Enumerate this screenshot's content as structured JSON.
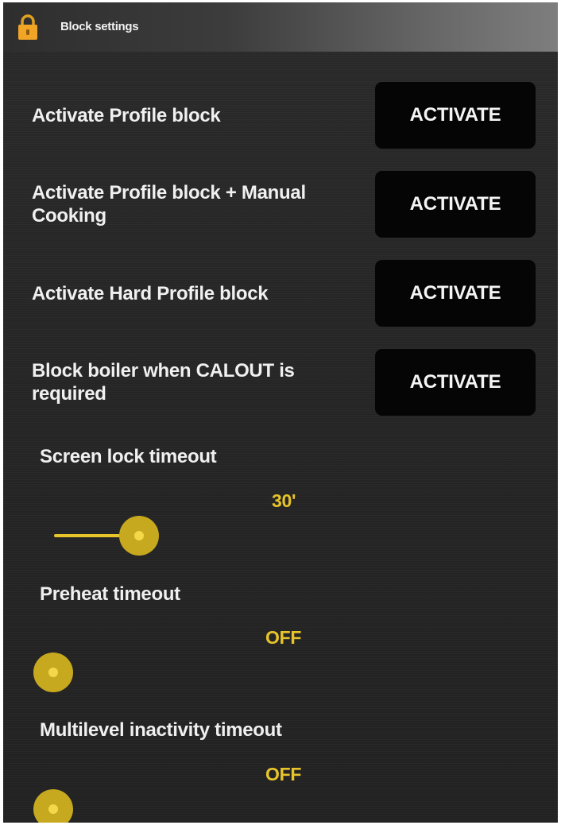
{
  "header": {
    "title": "Block settings",
    "icon": "lock-icon"
  },
  "rows": [
    {
      "label": "Activate Profile block",
      "button": "ACTIVATE"
    },
    {
      "label": "Activate Profile block + Manual Cooking",
      "button": "ACTIVATE"
    },
    {
      "label": "Activate Hard Profile block",
      "button": "ACTIVATE"
    },
    {
      "label": "Block boiler when CALOUT is required",
      "button": "ACTIVATE"
    }
  ],
  "sliders": [
    {
      "label": "Screen lock timeout",
      "value": "30'",
      "level": 0.19
    },
    {
      "label": "Preheat timeout",
      "value": "OFF",
      "level": 0
    },
    {
      "label": "Multilevel inactivity timeout",
      "value": "OFF",
      "level": 0
    }
  ],
  "colors": {
    "accent": "#e8c42a",
    "thumb": "#c7a91f",
    "button_bg": "#050505",
    "panel_bg": "#262626"
  }
}
